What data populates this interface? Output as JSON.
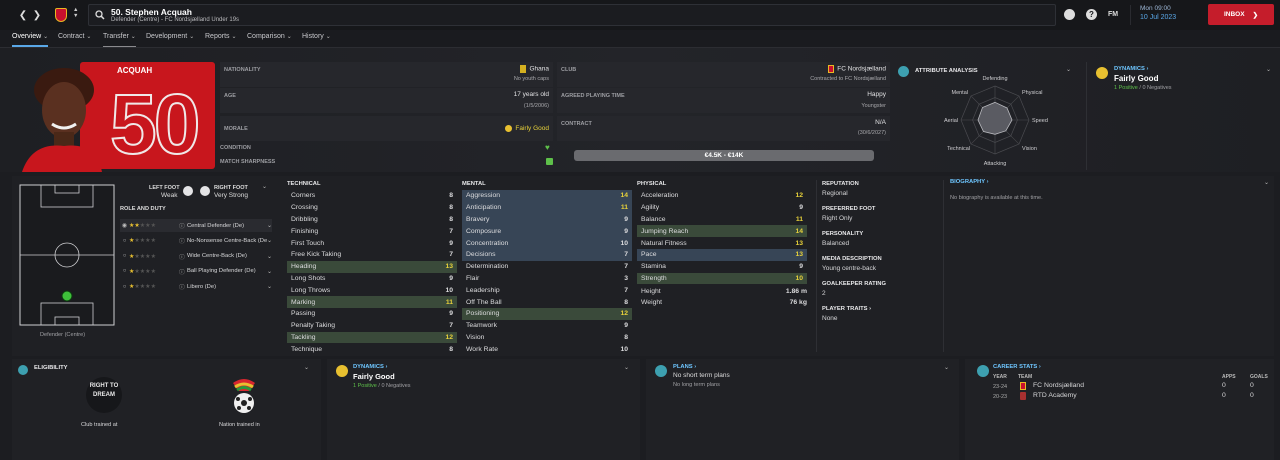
{
  "header": {
    "title": "50. Stephen Acquah",
    "subtitle": "Defender (Centre) - FC Nordsjælland Under 19s",
    "date_line1": "Mon 09:00",
    "date_line2": "10 Jul 2023",
    "inbox_label": "INBOX",
    "fm_label": "FM"
  },
  "tabs": [
    {
      "label": "Overview"
    },
    {
      "label": "Contract"
    },
    {
      "label": "Transfer"
    },
    {
      "label": "Development"
    },
    {
      "label": "Reports"
    },
    {
      "label": "Comparison"
    },
    {
      "label": "History"
    }
  ],
  "player": {
    "surname": "ACQUAH",
    "number": "50"
  },
  "info": {
    "nationality_label": "NATIONALITY",
    "nationality": "Ghana",
    "nationality_sub": "No youth caps",
    "club_label": "CLUB",
    "club": "FC Nordsjælland",
    "club_sub": "Contracted to FC Nordsjælland",
    "age_label": "AGE",
    "age": "17 years old",
    "age_sub": "(1/5/2006)",
    "apt_label": "AGREED PLAYING TIME",
    "apt": "Happy",
    "apt_sub": "Youngster",
    "morale_label": "MORALE",
    "morale": "Fairly Good",
    "contract_label": "CONTRACT",
    "contract": "N/A",
    "contract_sub": "(30/6/2027)",
    "condition_label": "CONDITION",
    "sharpness_label": "MATCH SHARPNESS",
    "value": "€4.5K - €14K"
  },
  "attribute_analysis": {
    "title": "ATTRIBUTE ANALYSIS",
    "labels": [
      "Defending",
      "Physical",
      "Speed",
      "Vision",
      "Attacking",
      "Technical",
      "Aerial",
      "Mental"
    ],
    "values": [
      0.52,
      0.5,
      0.5,
      0.45,
      0.42,
      0.48,
      0.5,
      0.52
    ]
  },
  "dynamics_top": {
    "title": "DYNAMICS",
    "value": "Fairly Good",
    "positive": "1 Positive",
    "negative": "0 Negatives"
  },
  "pitch": {
    "position_label": "Defender (Centre)"
  },
  "feet": {
    "left_label": "LEFT FOOT",
    "left_value": "Weak",
    "right_label": "RIGHT FOOT",
    "right_value": "Very Strong"
  },
  "roles_title": "ROLE AND DUTY",
  "roles": [
    {
      "name": "Central Defender (De)",
      "stars": 1.5
    },
    {
      "name": "No-Nonsense Centre-Back (De)",
      "stars": 1.0
    },
    {
      "name": "Wide Centre-Back (De)",
      "stars": 1.0
    },
    {
      "name": "Ball Playing Defender (De)",
      "stars": 1.0
    },
    {
      "name": "Libero (De)",
      "stars": 0.5
    }
  ],
  "technical": {
    "title": "TECHNICAL",
    "rows": [
      {
        "name": "Corners",
        "value": "8",
        "hl": ""
      },
      {
        "name": "Crossing",
        "value": "8",
        "hl": ""
      },
      {
        "name": "Dribbling",
        "value": "8",
        "hl": ""
      },
      {
        "name": "Finishing",
        "value": "7",
        "hl": ""
      },
      {
        "name": "First Touch",
        "value": "9",
        "hl": ""
      },
      {
        "name": "Free Kick Taking",
        "value": "7",
        "hl": ""
      },
      {
        "name": "Heading",
        "value": "13",
        "hl": "green"
      },
      {
        "name": "Long Shots",
        "value": "9",
        "hl": ""
      },
      {
        "name": "Long Throws",
        "value": "10",
        "hl": ""
      },
      {
        "name": "Marking",
        "value": "11",
        "hl": "green"
      },
      {
        "name": "Passing",
        "value": "9",
        "hl": ""
      },
      {
        "name": "Penalty Taking",
        "value": "7",
        "hl": ""
      },
      {
        "name": "Tackling",
        "value": "12",
        "hl": "green"
      },
      {
        "name": "Technique",
        "value": "8",
        "hl": ""
      }
    ]
  },
  "mental": {
    "title": "MENTAL",
    "rows": [
      {
        "name": "Aggression",
        "value": "14",
        "hl": "blue"
      },
      {
        "name": "Anticipation",
        "value": "11",
        "hl": "blue"
      },
      {
        "name": "Bravery",
        "value": "9",
        "hl": "blue"
      },
      {
        "name": "Composure",
        "value": "9",
        "hl": "blue"
      },
      {
        "name": "Concentration",
        "value": "10",
        "hl": "blue"
      },
      {
        "name": "Decisions",
        "value": "7",
        "hl": "blue"
      },
      {
        "name": "Determination",
        "value": "7",
        "hl": ""
      },
      {
        "name": "Flair",
        "value": "3",
        "hl": ""
      },
      {
        "name": "Leadership",
        "value": "7",
        "hl": ""
      },
      {
        "name": "Off The Ball",
        "value": "8",
        "hl": ""
      },
      {
        "name": "Positioning",
        "value": "12",
        "hl": "green"
      },
      {
        "name": "Teamwork",
        "value": "9",
        "hl": ""
      },
      {
        "name": "Vision",
        "value": "8",
        "hl": ""
      },
      {
        "name": "Work Rate",
        "value": "10",
        "hl": ""
      }
    ]
  },
  "physical": {
    "title": "PHYSICAL",
    "rows": [
      {
        "name": "Acceleration",
        "value": "12",
        "hl": ""
      },
      {
        "name": "Agility",
        "value": "9",
        "hl": ""
      },
      {
        "name": "Balance",
        "value": "11",
        "hl": ""
      },
      {
        "name": "Jumping Reach",
        "value": "14",
        "hl": "green"
      },
      {
        "name": "Natural Fitness",
        "value": "13",
        "hl": ""
      },
      {
        "name": "Pace",
        "value": "13",
        "hl": "blue"
      },
      {
        "name": "Stamina",
        "value": "9",
        "hl": ""
      },
      {
        "name": "Strength",
        "value": "10",
        "hl": "green"
      }
    ],
    "height_label": "Height",
    "height": "1.86 m",
    "weight_label": "Weight",
    "weight": "76 kg"
  },
  "details": {
    "reputation_label": "REPUTATION",
    "reputation": "Regional",
    "pref_foot_label": "PREFERRED FOOT",
    "pref_foot": "Right Only",
    "personality_label": "PERSONALITY",
    "personality": "Balanced",
    "media_label": "MEDIA DESCRIPTION",
    "media": "Young centre-back",
    "gk_label": "GOALKEEPER RATING",
    "gk": "2",
    "traits_label": "PLAYER TRAITS",
    "traits": "None"
  },
  "biography": {
    "title": "BIOGRAPHY",
    "text": "No biography is available at this time."
  },
  "eligibility": {
    "title": "ELIGIBILITY",
    "club_trained": "Club trained at",
    "nation_trained": "Nation trained in",
    "logo_text": "RIGHT TO DREAM"
  },
  "dynamics_bottom": {
    "title": "DYNAMICS",
    "value": "Fairly Good",
    "positive": "1 Positive",
    "negative": "0 Negatives"
  },
  "plans": {
    "title": "PLANS",
    "short": "No short term plans",
    "long": "No long term plans"
  },
  "career": {
    "title": "CAREER STATS",
    "col_year": "YEAR",
    "col_team": "TEAM",
    "col_apps": "APPS",
    "col_goals": "GOALS",
    "rows": [
      {
        "year": "23-24",
        "team": "FC Nordsjælland",
        "apps": "0",
        "goals": "0"
      },
      {
        "year": "20-23",
        "team": "RTD Academy",
        "apps": "0",
        "goals": "0"
      }
    ]
  },
  "colors": {
    "accent": "#5aa8e8",
    "inbox": "#c51d2b",
    "card": "#c8161d",
    "green_hl": "#3a4a3a",
    "blue_hl": "#374556",
    "yellow": "#e8d23a"
  }
}
